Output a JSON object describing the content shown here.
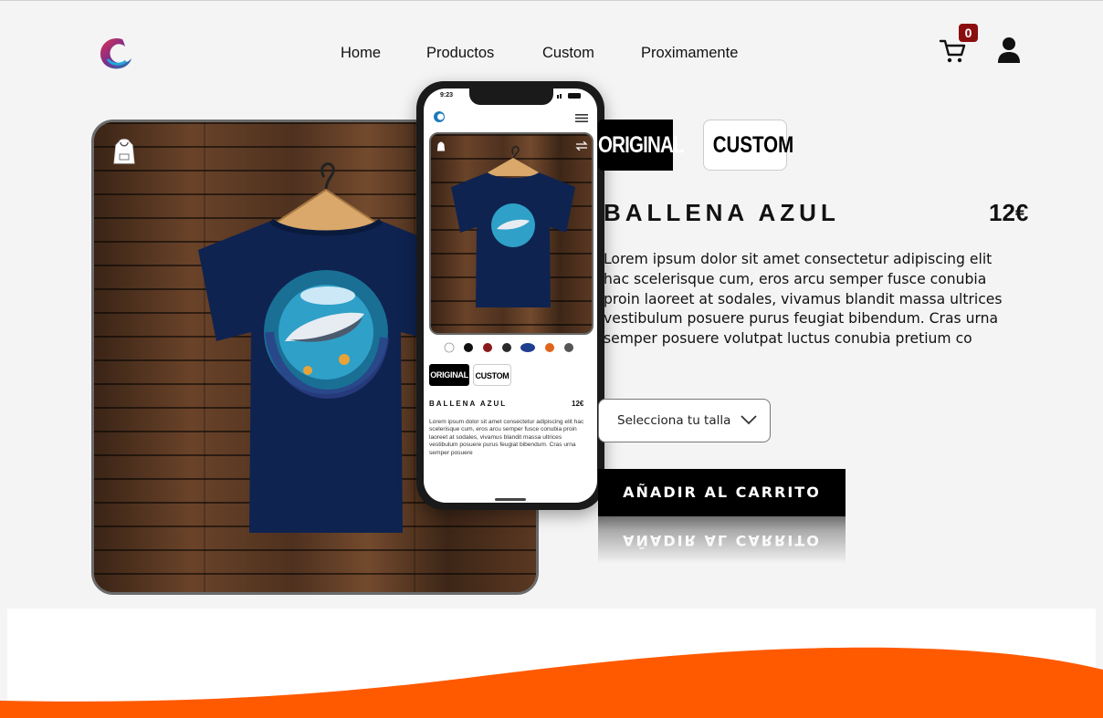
{
  "brand": {
    "logo_icon": "wave-logo-icon"
  },
  "nav": {
    "items": [
      {
        "label": "Home"
      },
      {
        "label": "Productos"
      },
      {
        "label": "Custom"
      },
      {
        "label": "Proximamente"
      }
    ]
  },
  "header": {
    "cart_icon": "cart-icon",
    "cart_count": "0",
    "user_icon": "user-icon"
  },
  "product": {
    "tabs": [
      {
        "label": "ORIGINAL",
        "active": true
      },
      {
        "label": "CUSTOM",
        "active": false
      }
    ],
    "title": "BALLENA AZUL",
    "price": "12€",
    "description": "Lorem ipsum dolor sit amet consectetur adipiscing elit hac scelerisque cum, eros arcu semper fusce conubia proin laoreet at sodales, vivamus blandit massa ultrices vestibulum posuere purus feugiat bibendum. Cras urna semper posuere volutpat luctus conubia pretium co",
    "size_select_label": "Selecciona tu talla",
    "add_to_cart": "AÑADIR AL CARRITO",
    "add_to_cart_reflection": "AÑADIR AL CARRITO"
  },
  "phone": {
    "time": "9:23",
    "tabs": [
      {
        "label": "ORIGINAL"
      },
      {
        "label": "CUSTOM"
      }
    ],
    "title": "BALLENA AZUL",
    "price": "12€",
    "description": "Lorem ipsum dolor sit amet consectetur adipiscing elit hac scelerisque cum, eros arcu semper fusce conubia proin laoreet at sodales, vivamus blandit massa ultrices vestibulum posuere purus feugiat bibendum. Cras urna semper posuere",
    "swatches": [
      "#ffffff",
      "#111111",
      "#8b1a1a",
      "#2a2a2a",
      "#1f3f8f",
      "#e0651a",
      "#555555"
    ]
  },
  "colors": {
    "accent_orange": "#ff5a00",
    "badge_red": "#8b0e0e",
    "shirt_navy": "#0f2350"
  }
}
